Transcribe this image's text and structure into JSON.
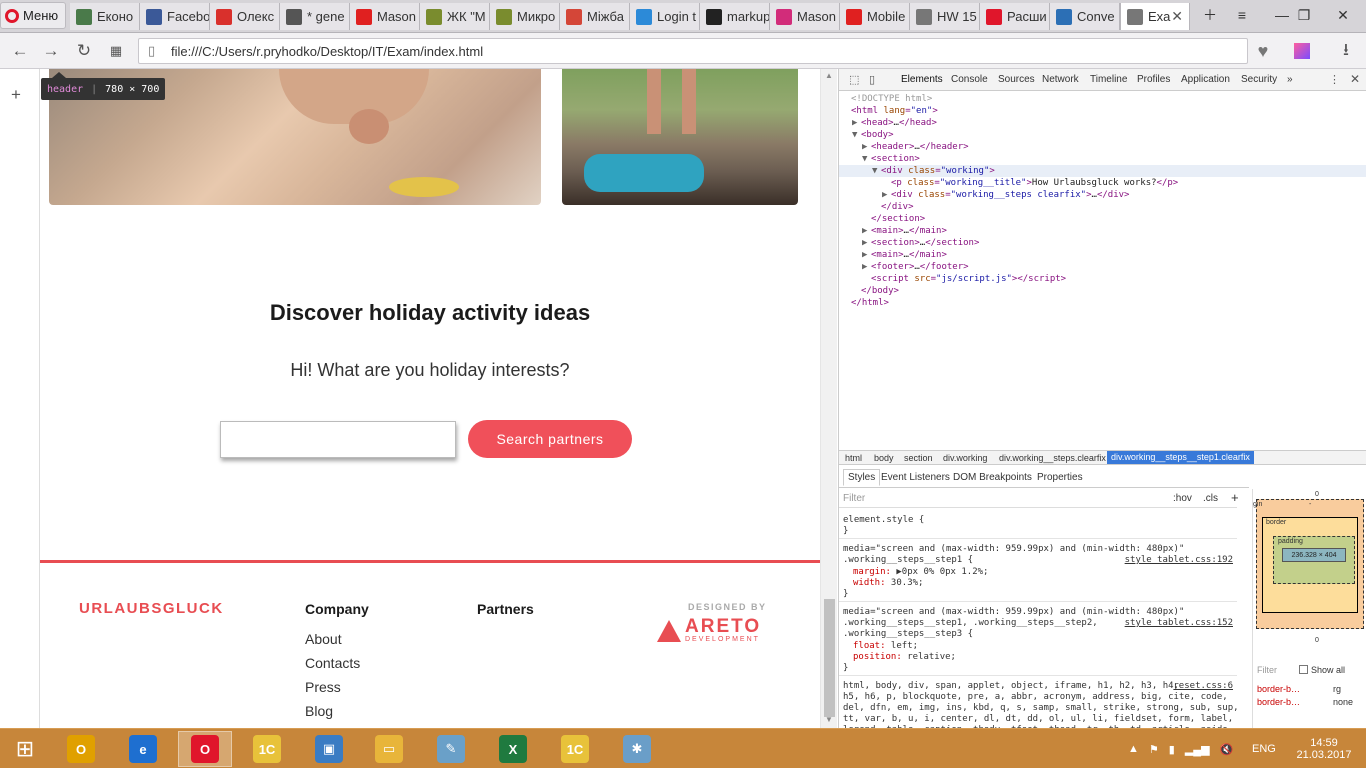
{
  "browser": {
    "menu_label": "Меню",
    "tabs": [
      {
        "label": "Еконо",
        "icon": "letter-e-icon",
        "color": "#4a7a4a"
      },
      {
        "label": "Facebo",
        "icon": "facebook-icon",
        "color": "#3b5998"
      },
      {
        "label": "Олекс",
        "icon": "hromadske-icon",
        "color": "#d9302c"
      },
      {
        "label": "* gene",
        "icon": "hash-icon",
        "color": "#555555"
      },
      {
        "label": "Mason",
        "icon": "youtube-icon",
        "color": "#e02020"
      },
      {
        "label": "ЖК \"М",
        "icon": "grid-icon",
        "color": "#7a8c2e"
      },
      {
        "label": "Микро",
        "icon": "grid-icon",
        "color": "#7a8c2e"
      },
      {
        "label": "Міжба",
        "icon": "gmail-icon",
        "color": "#d44638"
      },
      {
        "label": "Login t",
        "icon": "skype-icon",
        "color": "#2c8ad8"
      },
      {
        "label": "markup",
        "icon": "github-icon",
        "color": "#222222"
      },
      {
        "label": "Mason",
        "icon": "d-icon",
        "color": "#d22c7a"
      },
      {
        "label": "Mobile",
        "icon": "splash-icon",
        "color": "#e02020"
      },
      {
        "label": "HW 15",
        "icon": "document-icon",
        "color": "#777777"
      },
      {
        "label": "Расши",
        "icon": "opera-icon",
        "color": "#e0162b"
      },
      {
        "label": "Conve",
        "icon": "chat-icon",
        "color": "#2c6fb5"
      },
      {
        "label": "Exa",
        "icon": "document-icon",
        "color": "#777777"
      }
    ],
    "url": "file:///C:/Users/r.pryhodko/Desktop/IT/Exam/index.html"
  },
  "tooltip": {
    "tag": "header",
    "size": "780 × 700"
  },
  "page": {
    "section_title": "Discover holiday activity ideas",
    "section_subtitle": "Hi! What are you holiday interests?",
    "search_value": "",
    "search_button": "Search partners",
    "footer": {
      "brand": "URLAUBSGLUCK",
      "company_heading": "Company",
      "company_links": [
        "About",
        "Contacts",
        "Press",
        "Blog"
      ],
      "partners_heading": "Partners",
      "designed_by": "DESIGNED BY",
      "areto_name": "ARETO",
      "areto_sub": "DEVELOPMENT"
    }
  },
  "devtools": {
    "tabs": [
      "Elements",
      "Console",
      "Sources",
      "Network",
      "Timeline",
      "Profiles",
      "Application",
      "Security"
    ],
    "more": "»",
    "dom_lines": [
      {
        "indent": 0,
        "arrow": "",
        "html": "<!DOCTYPE html>",
        "kind": "cmt"
      },
      {
        "indent": 0,
        "arrow": "",
        "open": "html",
        "attrs": [
          [
            "lang",
            "en"
          ]
        ],
        "close": ""
      },
      {
        "indent": 1,
        "arrow": "▶",
        "open": "head",
        "attrs": [],
        "text": "…",
        "close": "head"
      },
      {
        "indent": 1,
        "arrow": "▼",
        "open": "body",
        "attrs": [],
        "close": ""
      },
      {
        "indent": 2,
        "arrow": "▶",
        "open": "header",
        "attrs": [],
        "text": "…",
        "close": "header"
      },
      {
        "indent": 2,
        "arrow": "▼",
        "open": "section",
        "attrs": [],
        "close": ""
      },
      {
        "indent": 3,
        "arrow": "▼",
        "open": "div",
        "attrs": [
          [
            "class",
            "working"
          ]
        ],
        "close": ""
      },
      {
        "indent": 4,
        "arrow": "",
        "open": "p",
        "attrs": [
          [
            "class",
            "working__title"
          ]
        ],
        "text": "How Urlaubsgluck works?",
        "close": "p"
      },
      {
        "indent": 4,
        "arrow": "▶",
        "open": "div",
        "attrs": [
          [
            "class",
            "working__steps clearfix"
          ]
        ],
        "text": "…",
        "close": "div"
      },
      {
        "indent": 3,
        "arrow": "",
        "closing": "div"
      },
      {
        "indent": 2,
        "arrow": "",
        "closing": "section"
      },
      {
        "indent": 2,
        "arrow": "▶",
        "open": "main",
        "attrs": [],
        "text": "…",
        "close": "main"
      },
      {
        "indent": 2,
        "arrow": "▶",
        "open": "section",
        "attrs": [],
        "text": "…",
        "close": "section"
      },
      {
        "indent": 2,
        "arrow": "▶",
        "open": "main",
        "attrs": [],
        "text": "…",
        "close": "main"
      },
      {
        "indent": 2,
        "arrow": "▶",
        "open": "footer",
        "attrs": [],
        "text": "…",
        "close": "footer"
      },
      {
        "indent": 2,
        "arrow": "",
        "open": "script",
        "attrs": [
          [
            "src",
            "js/script.js"
          ]
        ],
        "close": "script"
      },
      {
        "indent": 1,
        "arrow": "",
        "closing": "body"
      },
      {
        "indent": 0,
        "arrow": "",
        "closing": "html"
      }
    ],
    "breadcrumbs": [
      "html",
      "body",
      "section",
      "div.working",
      "div.working__steps.clearfix",
      "div.working__steps__step1.clearfix"
    ],
    "subtabs": [
      "Styles",
      "Event Listeners",
      "DOM Breakpoints",
      "Properties"
    ],
    "filter_placeholder": "Filter",
    "filter_hov": ":hov",
    "filter_cls": ".cls",
    "styles_lines": [
      {
        "text": "element.style {",
        "kind": "sel"
      },
      {
        "text": "}",
        "kind": "plain"
      },
      {
        "text": "media=\"screen and (max-width: 959.99px) and (min-width: 480px)\"",
        "kind": "plain"
      },
      {
        "text": ".working__steps__step1 {",
        "kind": "sel",
        "src": "style_tablet.css:192"
      },
      {
        "text": "margin:",
        "value": "▶0px 0% 0px 1.2%;",
        "kind": "prop"
      },
      {
        "text": "width:",
        "value": "30.3%;",
        "kind": "prop"
      },
      {
        "text": "}",
        "kind": "plain"
      },
      {
        "text": "media=\"screen and (max-width: 959.99px) and (min-width: 480px)\"",
        "kind": "plain"
      },
      {
        "text": ".working__steps__step1, .working__steps__step2,",
        "kind": "sel",
        "src": "style_tablet.css:152"
      },
      {
        "text": ".working__steps__step3 {",
        "kind": "sel"
      },
      {
        "text": "float:",
        "value": "left;",
        "kind": "prop"
      },
      {
        "text": "position:",
        "value": "relative;",
        "kind": "prop"
      },
      {
        "text": "}",
        "kind": "plain"
      },
      {
        "text": "html, body, div, span, applet, object, iframe, h1, h2, h3, h4,",
        "kind": "sel",
        "src": "reset.css:6"
      },
      {
        "text": "h5, h6, p, blockquote, pre, a, abbr, acronym, address, big, cite, code,",
        "kind": "sel"
      },
      {
        "text": "del, dfn, em, img, ins, kbd, q, s, samp, small, strike, strong, sub, sup,",
        "kind": "sel"
      },
      {
        "text": "tt, var, b, u, i, center, dl, dt, dd, ol, ul, li, fieldset, form, label,",
        "kind": "sel"
      },
      {
        "text": "legend, table, caption, tbody, tfoot, thead, tr, th, td, article, aside,",
        "kind": "sel"
      }
    ],
    "boxmodel": {
      "margin_label": "gin",
      "margin_top": "0",
      "margin_dash": "-",
      "border_label": "border",
      "padding_label": "padding",
      "content": "236.328 × 404",
      "bottom_zero": "0"
    },
    "computed": {
      "filter": "Filter",
      "show_all": "Show all",
      "props": [
        {
          "name": "border-b…",
          "value": "rg"
        },
        {
          "name": "border-b…",
          "value": "none"
        }
      ]
    }
  },
  "taskbar": {
    "apps": [
      {
        "name": "outlook",
        "label": "O",
        "color": "#e0a000"
      },
      {
        "name": "internet-explorer",
        "label": "e",
        "color": "#1e6fd0"
      },
      {
        "name": "opera",
        "label": "O",
        "color": "#e0162b"
      },
      {
        "name": "1c",
        "label": "1С",
        "color": "#e8c23a"
      },
      {
        "name": "remote-desktop",
        "label": "▣",
        "color": "#3a7cc3"
      },
      {
        "name": "file-explorer",
        "label": "▭",
        "color": "#e8b53a"
      },
      {
        "name": "notes",
        "label": "✎",
        "color": "#6aa0c8"
      },
      {
        "name": "excel",
        "label": "X",
        "color": "#1f7a3f"
      },
      {
        "name": "1c-enterprise",
        "label": "1С",
        "color": "#e8c23a"
      },
      {
        "name": "paint",
        "label": "✱",
        "color": "#6a9ec8"
      }
    ],
    "language": "ENG",
    "time": "14:59",
    "date": "21.03.2017"
  }
}
